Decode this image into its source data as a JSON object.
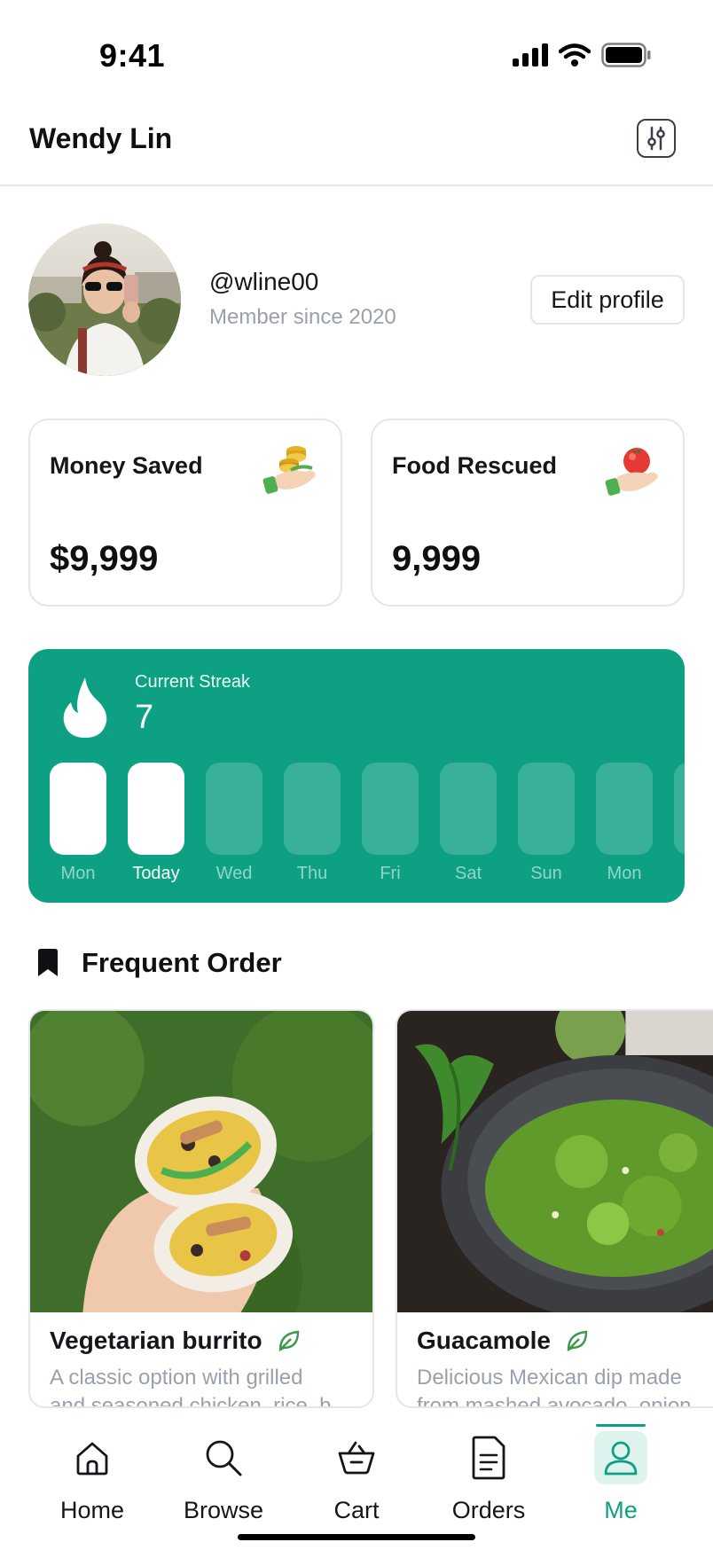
{
  "status": {
    "time": "9:41"
  },
  "header": {
    "name": "Wendy Lin"
  },
  "profile": {
    "handle": "@wline00",
    "member_since": "Member since 2020",
    "edit_label": "Edit profile"
  },
  "stats": [
    {
      "label": "Money Saved",
      "value": "$9,999",
      "icon": "coins-in-hand-icon"
    },
    {
      "label": "Food Rescued",
      "value": "9,999",
      "icon": "tomato-in-hand-icon"
    }
  ],
  "streak": {
    "label": "Current Streak",
    "value": "7",
    "days": [
      {
        "label": "Mon",
        "done": true
      },
      {
        "label": "Today",
        "done": true
      },
      {
        "label": "Wed",
        "done": false
      },
      {
        "label": "Thu",
        "done": false
      },
      {
        "label": "Fri",
        "done": false
      },
      {
        "label": "Sat",
        "done": false
      },
      {
        "label": "Sun",
        "done": false
      },
      {
        "label": "Mon",
        "done": false
      }
    ]
  },
  "frequent": {
    "title": "Frequent Order",
    "items": [
      {
        "name": "Vegetarian burrito",
        "desc1": "A classic option with grilled",
        "desc2": "and seasoned chicken, rice, b..."
      },
      {
        "name": "Guacamole",
        "desc1": "Delicious Mexican dip made",
        "desc2": "from mashed avocado, onion..."
      }
    ]
  },
  "tabs": [
    {
      "label": "Home",
      "icon": "home-icon"
    },
    {
      "label": "Browse",
      "icon": "search-icon"
    },
    {
      "label": "Cart",
      "icon": "basket-icon"
    },
    {
      "label": "Orders",
      "icon": "document-icon"
    },
    {
      "label": "Me",
      "icon": "user-icon",
      "active": true
    }
  ],
  "colors": {
    "accent": "#0ea083",
    "muted": "#9aa0ac"
  }
}
